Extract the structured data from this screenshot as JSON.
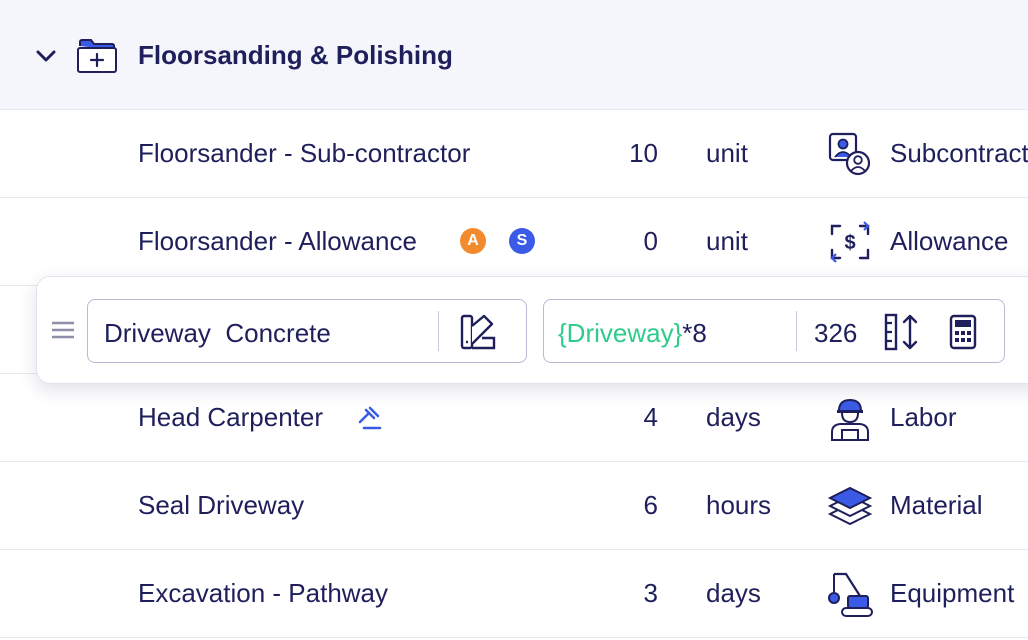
{
  "group": {
    "title": "Floorsanding & Polishing",
    "icons": {
      "toggle": "chevron-down-icon",
      "folder": "folder-add-icon"
    }
  },
  "rows": [
    {
      "name": "Floorsander - Sub-contractor",
      "qty": "10",
      "unit": "unit",
      "type": "Subcontractor",
      "type_icon": "subcontractor-icon"
    },
    {
      "name": "Floorsander - Allowance",
      "qty": "0",
      "unit": "unit",
      "type": "Allowance",
      "type_icon": "allowance-icon",
      "badges": [
        "A",
        "S"
      ]
    },
    {
      "name": "Head Carpenter",
      "qty": "4",
      "unit": "days",
      "type": "Labor",
      "type_icon": "labor-icon",
      "flag_icon": "gavel-icon"
    },
    {
      "name": "Seal Driveway",
      "qty": "6",
      "unit": "hours",
      "type": "Material",
      "type_icon": "material-icon"
    },
    {
      "name": "Excavation - Pathway",
      "qty": "3",
      "unit": "days",
      "type": "Equipment",
      "type_icon": "equipment-icon"
    }
  ],
  "edit_row": {
    "name_value": "Driveway  Concrete",
    "formula_var": "{Driveway}",
    "formula_rest": "*8",
    "result": "326",
    "icons": [
      "drag-handle-icon",
      "swatch-icon",
      "measure-icon",
      "calculator-icon"
    ]
  },
  "colors": {
    "text": "#1f1f5c",
    "accent_blue": "#3b5be6",
    "badge_orange": "#f28a2e",
    "formula_green": "#2ecc8a",
    "header_bg": "#f5f6fc"
  }
}
